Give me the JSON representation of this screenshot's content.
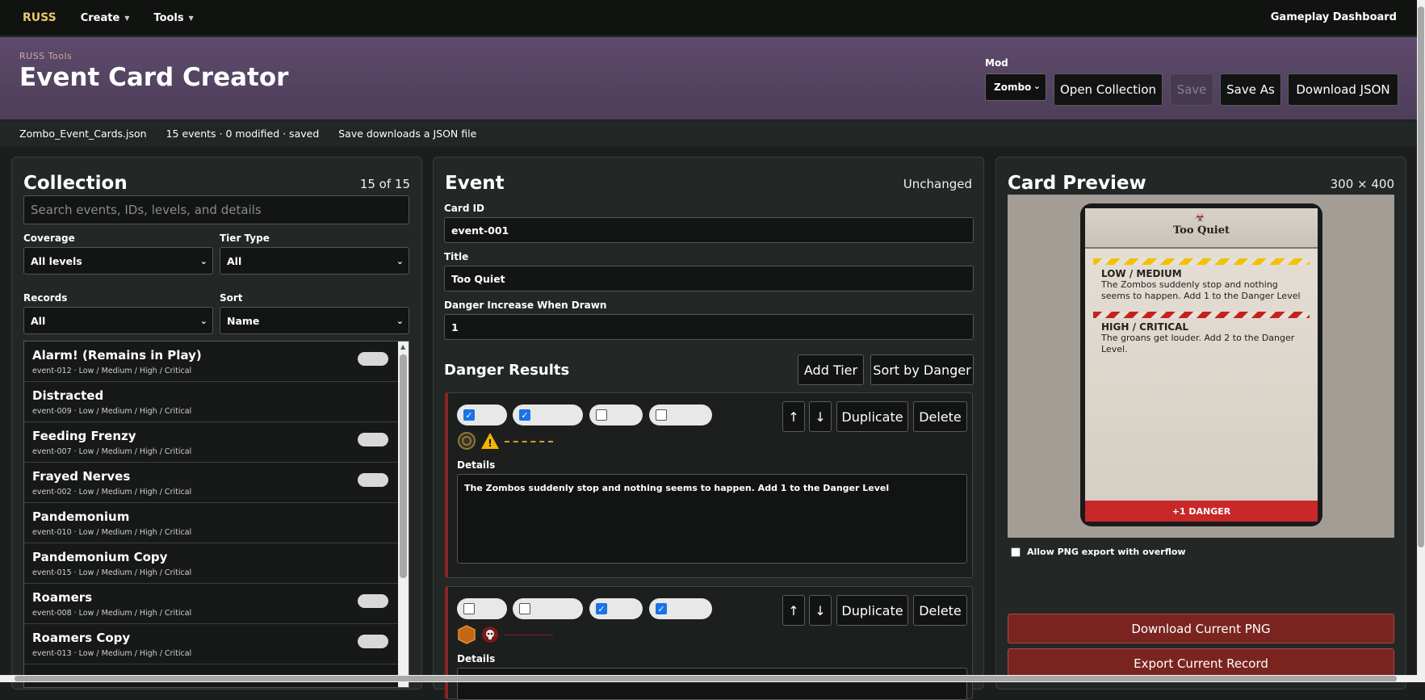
{
  "nav": {
    "brand": "RUSS",
    "create": "Create",
    "tools": "Tools",
    "right": "Gameplay Dashboard"
  },
  "hero": {
    "kicker": "RUSS Tools",
    "title": "Event Card Creator",
    "mod_label": "Mod",
    "mod_value": "Zombo",
    "open": "Open Collection",
    "save": "Save",
    "save_as": "Save As",
    "download": "Download JSON"
  },
  "status": {
    "file": "Zombo_Event_Cards.json",
    "counts": "15 events · 0 modified · saved",
    "note": "Save downloads a JSON file"
  },
  "collection": {
    "title": "Collection",
    "count": "15 of 15",
    "search_placeholder": "Search events, IDs, levels, and details",
    "coverage_label": "Coverage",
    "coverage_value": "All levels",
    "tier_label": "Tier Type",
    "tier_value": "All",
    "records_label": "Records",
    "records_value": "All",
    "sort_label": "Sort",
    "sort_value": "Name",
    "items": [
      {
        "title": "Alarm! (Remains in Play)",
        "sub": "event-012 · Low / Medium / High / Critical",
        "badge": true
      },
      {
        "title": "Distracted",
        "sub": "event-009 · Low / Medium / High / Critical",
        "badge": false
      },
      {
        "title": "Feeding Frenzy",
        "sub": "event-007 · Low / Medium / High / Critical",
        "badge": true
      },
      {
        "title": "Frayed Nerves",
        "sub": "event-002 · Low / Medium / High / Critical",
        "badge": true
      },
      {
        "title": "Pandemonium",
        "sub": "event-010 · Low / Medium / High / Critical",
        "badge": false
      },
      {
        "title": "Pandemonium Copy",
        "sub": "event-015 · Low / Medium / High / Critical",
        "badge": false
      },
      {
        "title": "Roamers",
        "sub": "event-008 · Low / Medium / High / Critical",
        "badge": true
      },
      {
        "title": "Roamers Copy",
        "sub": "event-013 · Low / Medium / High / Critical",
        "badge": true
      }
    ]
  },
  "event": {
    "title": "Event",
    "state": "Unchanged",
    "card_id_label": "Card ID",
    "card_id": "event-001",
    "title_label": "Title",
    "title_value": "Too Quiet",
    "danger_label": "Danger Increase When Drawn",
    "danger_value": "1",
    "results_title": "Danger Results",
    "add_tier": "Add Tier",
    "sort_danger": "Sort by Danger",
    "up": "↑",
    "down": "↓",
    "duplicate": "Duplicate",
    "delete": "Delete",
    "details_label": "Details",
    "tiers": [
      {
        "checks": [
          true,
          true,
          false,
          false
        ],
        "details": "The Zombos suddenly stop and nothing seems to happen. Add 1 to the Danger Level"
      },
      {
        "checks": [
          false,
          false,
          true,
          true
        ],
        "details": ""
      }
    ]
  },
  "preview": {
    "title": "Card Preview",
    "size": "300 × 400",
    "card_title": "Too Quiet",
    "tier1_head": "LOW / MEDIUM",
    "tier1_text": "The Zombos suddenly stop and nothing seems to happen. Add 1 to the Danger Level",
    "tier2_head": "HIGH / CRITICAL",
    "tier2_text": "The groans get louder. Add 2 to the Danger Level.",
    "footer": "+1 DANGER",
    "overflow_label": "Allow PNG export with overflow",
    "download_png": "Download Current PNG",
    "export_record": "Export Current Record"
  },
  "colors": {
    "accent_red": "#7a2420",
    "hero_purple": "#5e4a6c",
    "brand_gold": "#e8c86a",
    "checkbox_blue": "#1a73e8"
  }
}
